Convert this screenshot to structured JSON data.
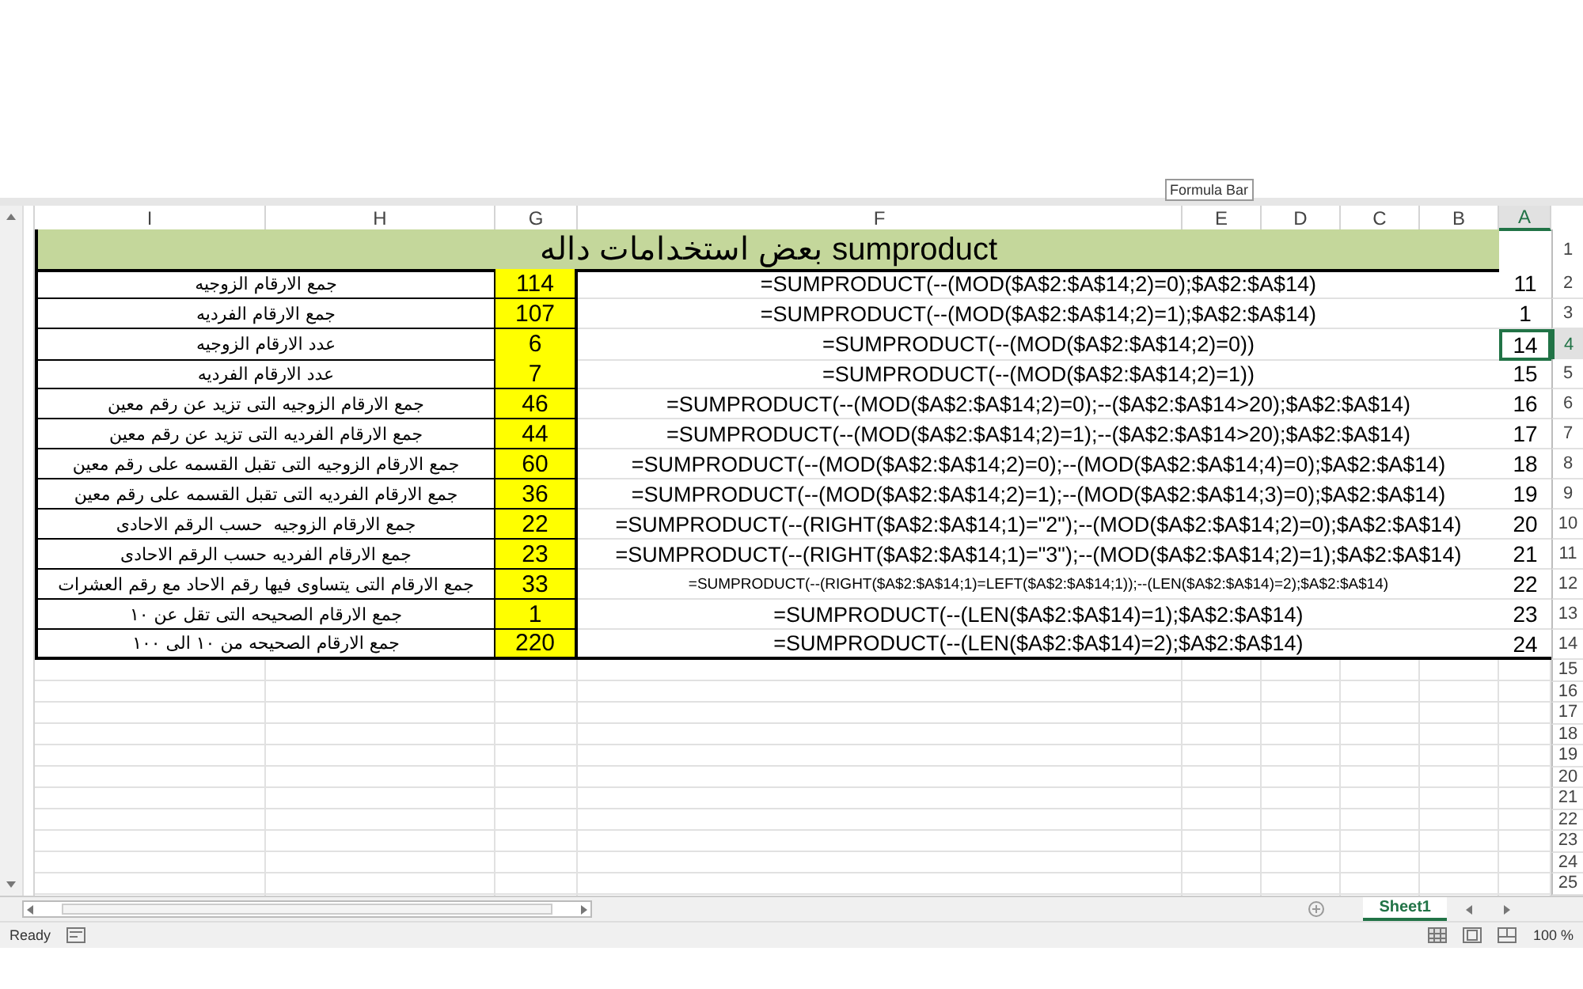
{
  "tooltip": "Formula Bar",
  "column_headers": [
    {
      "label": "A",
      "selected": true
    },
    {
      "label": "B",
      "selected": false
    },
    {
      "label": "C",
      "selected": false
    },
    {
      "label": "D",
      "selected": false
    },
    {
      "label": "E",
      "selected": false
    },
    {
      "label": "F",
      "selected": false
    },
    {
      "label": "G",
      "selected": false
    },
    {
      "label": "H",
      "selected": false
    },
    {
      "label": "I",
      "selected": false
    }
  ],
  "title": "بعض استخدامات داله sumproduct",
  "rows": [
    {
      "label": "جمع الارقام الزوجيه",
      "result": "114",
      "formula": "=SUMPRODUCT(--(MOD($A$2:$A$14;2)=0);$A$2:$A$14)",
      "kind": "normal",
      "value": "11",
      "selected": false
    },
    {
      "label": "جمع الارقام الفرديه",
      "result": "107",
      "formula": "=SUMPRODUCT(--(MOD($A$2:$A$14;2)=1);$A$2:$A$14)",
      "kind": "normal",
      "value": "1",
      "selected": false
    },
    {
      "label": "عدد الارقام الزوجيه",
      "result": "6",
      "formula": "=SUMPRODUCT(--(MOD($A$2:$A$14;2)=0))",
      "kind": "normal",
      "value": "14",
      "selected": true
    },
    {
      "label": "عدد الارقام الفرديه",
      "result": "7",
      "formula": "=SUMPRODUCT(--(MOD($A$2:$A$14;2)=1))",
      "kind": "normal",
      "value": "15",
      "selected": false
    },
    {
      "label": "جمع الارقام الزوجيه التى تزيد عن رقم معين",
      "result": "46",
      "formula": "=SUMPRODUCT(--(MOD($A$2:$A$14;2)=0);--($A$2:$A$14>20);$A$2:$A$14)",
      "kind": "normal",
      "value": "16",
      "selected": false
    },
    {
      "label": "جمع الارقام الفرديه التى تزيد عن رقم معين",
      "result": "44",
      "formula": "=SUMPRODUCT(--(MOD($A$2:$A$14;2)=1);--($A$2:$A$14>20);$A$2:$A$14)",
      "kind": "normal",
      "value": "17",
      "selected": false
    },
    {
      "label": "جمع الارقام الزوجيه التى تقبل القسمه على رقم معين",
      "result": "60",
      "formula": "=SUMPRODUCT(--(MOD($A$2:$A$14;2)=0);--(MOD($A$2:$A$14;4)=0);$A$2:$A$14)",
      "kind": "normal",
      "value": "18",
      "selected": false
    },
    {
      "label": "جمع الارقام الفرديه التى تقبل القسمه على رقم معين",
      "result": "36",
      "formula": "=SUMPRODUCT(--(MOD($A$2:$A$14;2)=1);--(MOD($A$2:$A$14;3)=0);$A$2:$A$14)",
      "kind": "normal",
      "value": "19",
      "selected": false
    },
    {
      "label": "جمع الارقام الزوجيه  حسب الرقم الاحادى",
      "result": "22",
      "formula": "=SUMPRODUCT(--(RIGHT($A$2:$A$14;1)=\"2\");--(MOD($A$2:$A$14;2)=0);$A$2:$A$14)",
      "kind": "normal",
      "value": "20",
      "selected": false
    },
    {
      "label": "جمع الارقام الفرديه حسب الرقم الاحادى",
      "result": "23",
      "formula": "=SUMPRODUCT(--(RIGHT($A$2:$A$14;1)=\"3\");--(MOD($A$2:$A$14;2)=1);$A$2:$A$14)",
      "kind": "normal",
      "value": "21",
      "selected": false
    },
    {
      "label": "جمع الارقام التى يتساوى فيها رقم الاحاد مع رقم العشرات",
      "result": "33",
      "formula": "=SUMPRODUCT(--(RIGHT($A$2:$A$14;1)=LEFT($A$2:$A$14;1));--(LEN($A$2:$A$14)=2);$A$2:$A$14)",
      "kind": "compact",
      "value": "22",
      "selected": false
    },
    {
      "label": "جمع الارقام الصحيحه التى تقل عن ١٠",
      "result": "1",
      "formula": "=SUMPRODUCT(--(LEN($A$2:$A$14)=1);$A$2:$A$14)",
      "kind": "normal",
      "value": "23",
      "selected": false
    },
    {
      "label": "جمع الارقام الصحيحه من ١٠ الى ١٠٠",
      "result": "220",
      "formula": "=SUMPRODUCT(--(LEN($A$2:$A$14)=2);$A$2:$A$14)",
      "kind": "normal",
      "value": "24",
      "selected": false
    }
  ],
  "row_numbers": [
    {
      "label": "1",
      "selected": false
    },
    {
      "label": "2",
      "selected": false
    },
    {
      "label": "3",
      "selected": false
    },
    {
      "label": "4",
      "selected": true
    },
    {
      "label": "5",
      "selected": false
    },
    {
      "label": "6",
      "selected": false
    },
    {
      "label": "7",
      "selected": false
    },
    {
      "label": "8",
      "selected": false
    },
    {
      "label": "9",
      "selected": false
    },
    {
      "label": "10",
      "selected": false
    },
    {
      "label": "11",
      "selected": false
    },
    {
      "label": "12",
      "selected": false
    },
    {
      "label": "13",
      "selected": false
    },
    {
      "label": "14",
      "selected": false
    },
    {
      "label": "15",
      "selected": false
    },
    {
      "label": "16",
      "selected": false
    },
    {
      "label": "17",
      "selected": false
    },
    {
      "label": "18",
      "selected": false
    },
    {
      "label": "19",
      "selected": false
    },
    {
      "label": "20",
      "selected": false
    },
    {
      "label": "21",
      "selected": false
    },
    {
      "label": "22",
      "selected": false
    },
    {
      "label": "23",
      "selected": false
    },
    {
      "label": "24",
      "selected": false
    },
    {
      "label": "25",
      "selected": false
    }
  ],
  "sheet_tabs": [
    {
      "label": "Sheet1",
      "selected": true
    }
  ],
  "status_bar": {
    "status": "Ready",
    "zoom": "100 %"
  }
}
